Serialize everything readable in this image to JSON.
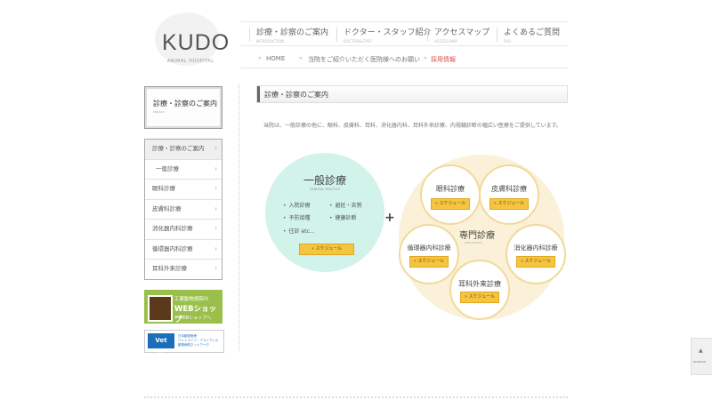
{
  "logo": {
    "name": "KUDO",
    "sub": "ANIMAL HOSPITAL"
  },
  "gnav": [
    {
      "label": "診療・診察のご案内",
      "en": "INTRODUCTION"
    },
    {
      "label": "ドクター・スタッフ紹介",
      "en": "DOCTOR&STAFF"
    },
    {
      "label": "アクセスマップ",
      "en": "ACCESS MAP"
    },
    {
      "label": "よくあるご質問",
      "en": "FAQ"
    }
  ],
  "subnav": [
    {
      "label": "HOME"
    },
    {
      "label": "当院をご紹介いただく医院様へのお願い"
    },
    {
      "label": "採用情報"
    }
  ],
  "sidebar": {
    "title": "診療・診察のご案内",
    "title_en": "SERVICE",
    "menu": [
      "診療・診察のご案内",
      "一般診療",
      "眼科診療",
      "皮膚科診療",
      "消化器内科診療",
      "循環器内科診療",
      "耳科外来診療"
    ],
    "banner_web": {
      "line1": "工藤動物病院の",
      "line2": "WEBショップ",
      "line3": "» WEBショップへ"
    },
    "banner_vetlife": {
      "logo": "Vet Life",
      "line1": "日本動物医療",
      "line2": "ベットライフ・アライアンス",
      "line3": "動物病院ネットワーク"
    }
  },
  "main": {
    "heading": "診療・診察のご案内",
    "intro": "当院は、一般診療の他に、眼科、皮膚科、耳科、消化器内科、耳科外来診療、内視鏡診断の幅広い医療をご提供しています。",
    "general": {
      "title": "一般診療",
      "en": "GENERAL PRACTICE",
      "items": [
        "入院診療",
        "避妊・去勢",
        "予防接種",
        "健康診断",
        "往診 etc..."
      ],
      "schedule": "» スケジュール"
    },
    "plus": "+",
    "special": {
      "title": "専門診療",
      "en": "SPECIALIZED",
      "depts": [
        {
          "name": "眼科診療",
          "schedule": "» スケジュール"
        },
        {
          "name": "皮膚科診療",
          "schedule": "» スケジュール"
        },
        {
          "name": "循環器内科診療",
          "schedule": "» スケジュール"
        },
        {
          "name": "消化器内科診療",
          "schedule": "» スケジュール"
        },
        {
          "name": "耳科外来診療",
          "schedule": "» スケジュール"
        }
      ]
    }
  },
  "pagetop": {
    "label": "PAGETOP"
  },
  "colors": {
    "general_bg": "#d1f3ea",
    "special_bg": "#fbf1d9",
    "schedule_btn": "#f5c542",
    "banner_green": "#9ac04b",
    "vetlife_blue": "#1c6eb8"
  }
}
